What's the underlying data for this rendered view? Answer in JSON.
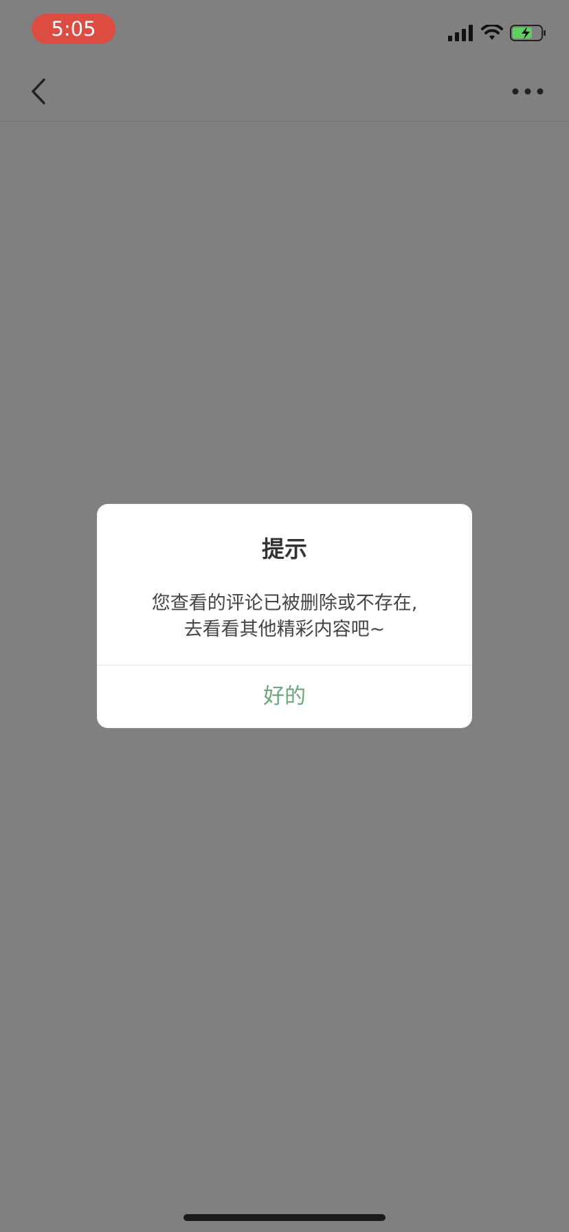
{
  "status_bar": {
    "time": "5:05",
    "time_pill_color": "#dc4c40",
    "icons": [
      "signal-icon",
      "wifi-icon",
      "battery-charging-icon"
    ]
  },
  "nav_bar": {
    "back_icon": "chevron-left-icon",
    "more_icon": "more-horizontal-icon"
  },
  "dialog": {
    "title": "提示",
    "message_line1": "您查看的评论已被删除或不存在,",
    "message_line2": "去看看其他精彩内容吧~",
    "confirm_label": "好的",
    "confirm_color": "#6aa977"
  },
  "colors": {
    "background": "#808080",
    "dialog_background": "#ffffff"
  }
}
